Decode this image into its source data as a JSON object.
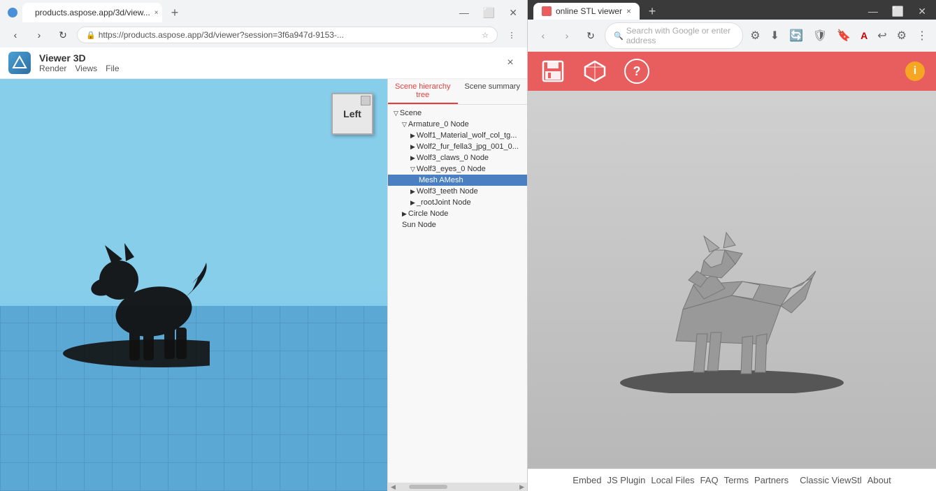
{
  "leftBrowser": {
    "tab": {
      "label": "products.aspose.app/3d/view...",
      "favicon": "3d"
    },
    "addressBar": {
      "url": "https://products.aspose.app/3d/viewer?session=3f6a947d-9153-..."
    },
    "app": {
      "title": "Viewer 3D",
      "menu": [
        "Render",
        "Views",
        "File"
      ],
      "closeLabel": "×"
    },
    "viewport": {
      "cubeLabel": "Left"
    },
    "hierarchy": {
      "tabs": [
        "Scene hierarchy tree",
        "Scene summary"
      ],
      "activeTab": "Scene hierarchy tree",
      "items": [
        {
          "label": "Scene",
          "indent": 0,
          "type": "expand",
          "selected": false
        },
        {
          "label": "Armature_0 Node",
          "indent": 1,
          "type": "expand",
          "selected": false
        },
        {
          "label": "Wolf1_Material_wolf_col_tg...",
          "indent": 2,
          "type": "arrow",
          "selected": false
        },
        {
          "label": "Wolf2_fur_fella3_jpg_001_0...",
          "indent": 2,
          "type": "arrow",
          "selected": false
        },
        {
          "label": "Wolf3_claws_0 Node",
          "indent": 2,
          "type": "arrow",
          "selected": false
        },
        {
          "label": "Wolf3_eyes_0 Node",
          "indent": 2,
          "type": "expand",
          "selected": false
        },
        {
          "label": "Mesh AMesh",
          "indent": 3,
          "type": "none",
          "selected": true
        },
        {
          "label": "Wolf3_teeth Node",
          "indent": 2,
          "type": "arrow",
          "selected": false
        },
        {
          "label": "_rootJoint Node",
          "indent": 2,
          "type": "arrow",
          "selected": false
        },
        {
          "label": "Circle Node",
          "indent": 1,
          "type": "arrow",
          "selected": false
        },
        {
          "label": "Sun Node",
          "indent": 1,
          "type": "none",
          "selected": false
        }
      ]
    }
  },
  "rightBrowser": {
    "tab": {
      "label": "online STL viewer"
    },
    "addressBar": {
      "placeholder": "Search with Google or enter address"
    },
    "toolbar": {
      "saveIcon": "💾",
      "boxIcon": "📦",
      "helpIcon": "?",
      "infoBadge": "i"
    },
    "footer": {
      "links": [
        "JS Plugin",
        "Local Files",
        "FAQ",
        "Terms",
        "Partners",
        "Classic ViewStl",
        "About"
      ]
    }
  },
  "colors": {
    "toolbarRed": "#e85d5d",
    "selectedBlue": "#4a7fc1",
    "infoBadgeOrange": "#f5a623"
  }
}
